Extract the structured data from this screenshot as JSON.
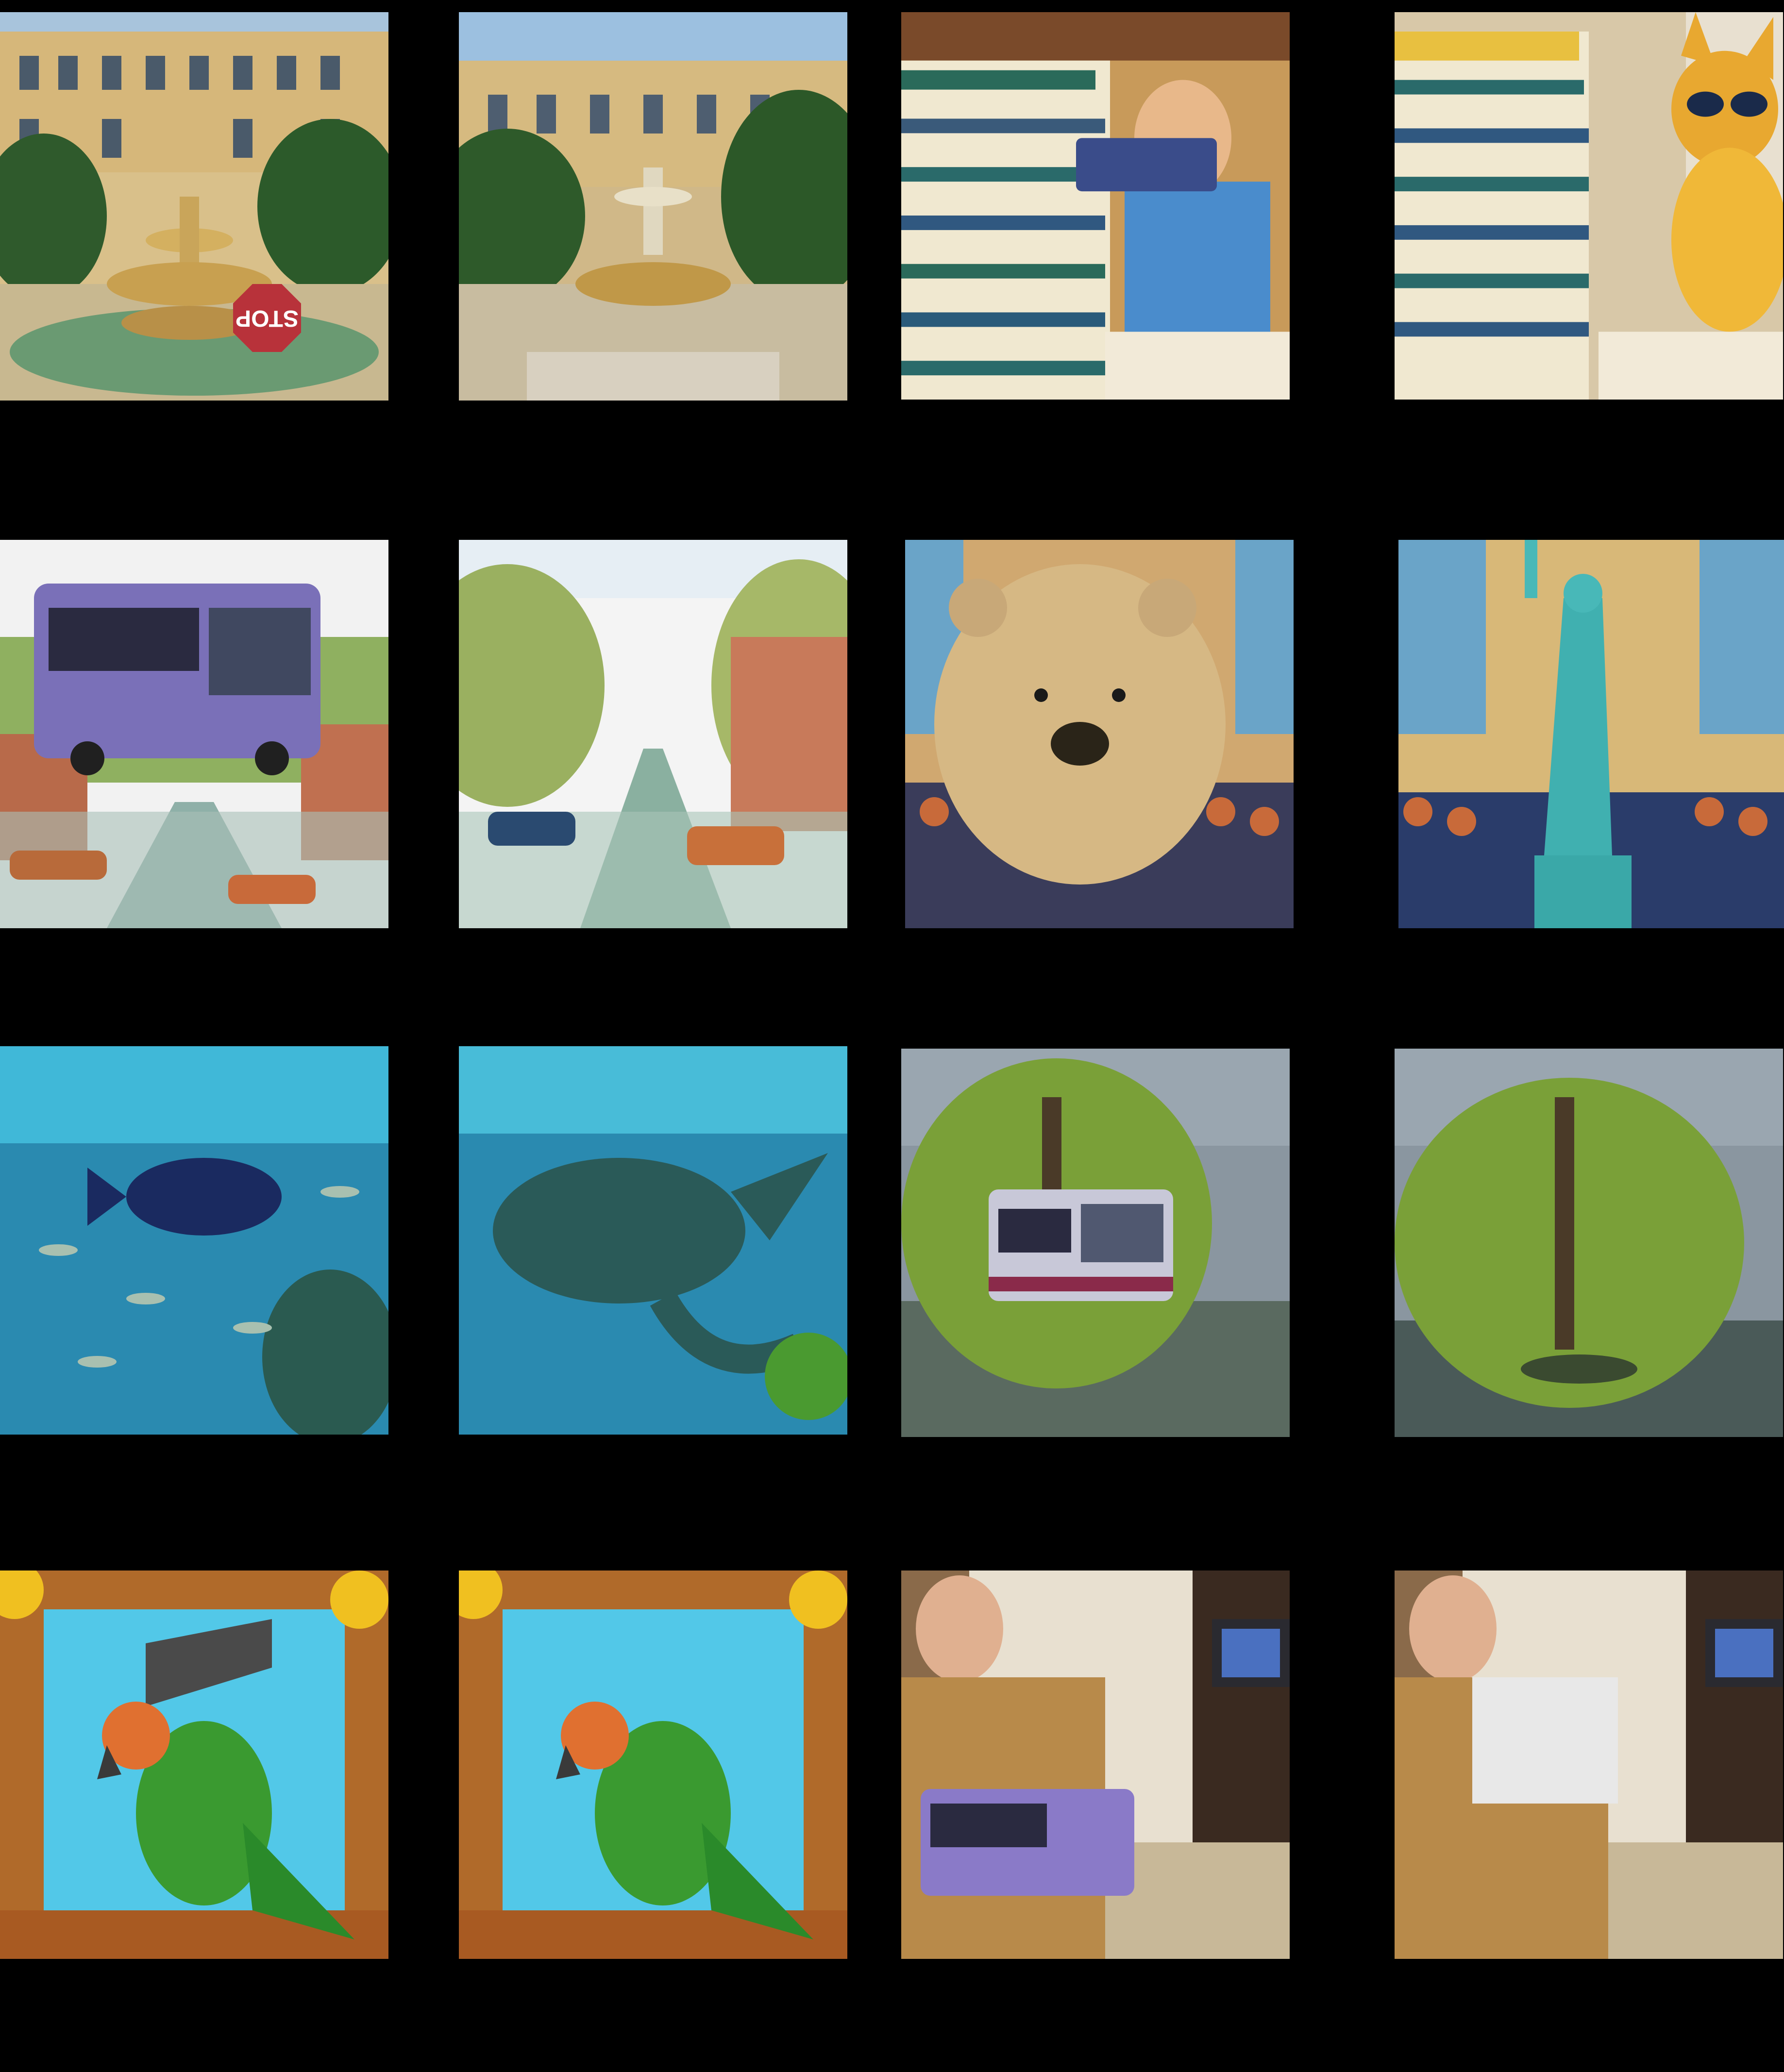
{
  "grid": {
    "background": "#000000",
    "rows": 4,
    "columns": 4
  },
  "tiles": [
    {
      "subject": "palace-fountain-with-stop-sign",
      "sign_text": "STOP"
    },
    {
      "subject": "palace-fountain"
    },
    {
      "subject": "books-with-child-and-glasses"
    },
    {
      "subject": "books-with-cat-in-sunglasses"
    },
    {
      "subject": "canal-with-bus"
    },
    {
      "subject": "canal-watercolor"
    },
    {
      "subject": "crowd-with-bear"
    },
    {
      "subject": "crowd-with-statue-of-liberty"
    },
    {
      "subject": "underwater-fish"
    },
    {
      "subject": "underwater-crocodile"
    },
    {
      "subject": "willow-tree-with-bus"
    },
    {
      "subject": "willow-tree"
    },
    {
      "subject": "parrot-with-brick"
    },
    {
      "subject": "parrot-window"
    },
    {
      "subject": "old-man-tv-with-bus"
    },
    {
      "subject": "old-man-tv"
    }
  ]
}
